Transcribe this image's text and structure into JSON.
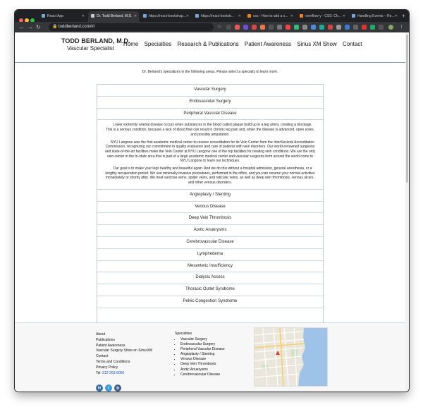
{
  "browser": {
    "tabs": [
      {
        "label": "React App"
      },
      {
        "label": "Dr. Todd Berland, M.D."
      },
      {
        "label": "https://react-bootstrap..."
      },
      {
        "label": "https://react-bootstr..."
      },
      {
        "label": "css - How to add a s..."
      },
      {
        "label": "overflow-y - CSS: Ch..."
      },
      {
        "label": "Handling Events – Re..."
      }
    ],
    "url": "toddberland.com/#/",
    "colors": {
      "close": "#ff5f57",
      "minimize": "#febc2e",
      "maximize": "#28c840"
    }
  },
  "site": {
    "brand_name": "TODD BERLAND, M.D.",
    "brand_sub": "Vascular Specialist",
    "nav": [
      "Home",
      "Specialties",
      "Research & Publications",
      "Patient Awareness",
      "Sirius XM Show",
      "Contact"
    ]
  },
  "main": {
    "intro": "Dr. Berland's specializes in the following areas. Please select a specialty to learn more.",
    "specialties_top": [
      "Vascular Surgery",
      "Endovascular Surgery",
      "Peripheral Vascular Disease"
    ],
    "expanded_paragraphs": [
      "Lower extremity arterial disease occurs when substances in the blood called plaque build up in a leg artery, creating a blockage. This is a serious condition, because a lack of blood flow can result in chronic leg pain and, when the disease is advanced, open sores, and possibly amputation.",
      "NYU Langone was the first academic medical center to receive accreditation for its Vein Center from the InterSocietal Accreditation Commission, recognizing our commitment to quality evaluation and care of patients with vein disorders. Our world-renowned surgeons and state-of-the-art facilities make the Vein Center at NYU Langone one of the top facilities for treating vein conditions. We are the only vein center in the tri-state area that is part of a large academic medical center and vascular surgeons from around the world come to NYU Langone to learn our techniques.",
      "Our goal is to make your legs healthy and beautiful again. And we do this without a hospital admission, general anesthesia, or a lengthy recuperation period. We use minimally invasive procedures, performed in the office, and you can resume your normal activities immediately or shortly after. We treat varicose veins, spider veins, and reticular veins, as well as deep vein thrombosis, venous ulcers, and other venous disorders."
    ],
    "specialties_bottom": [
      "Angioplasty / Stenting",
      "Venous Disease",
      "Deep Vein Thrombosis",
      "Aortic Anuerysms",
      "Cerebrovascular Disease",
      "Lymphedema",
      "Mesenteric Insufficiency",
      "Dialysis Access",
      "Thoracic Outlet Syndrome",
      "Pelvic Congestion Syndrome"
    ]
  },
  "footer": {
    "links": [
      "About",
      "Publications",
      "Patient Awareness",
      "Vascular Surgery Show on SiriusXM",
      "Contact",
      "Terms and Conditions",
      "Privacy Policy"
    ],
    "tel_label": "Tel:",
    "tel_number": "212-263-5060",
    "specialties_title": "Specialties",
    "specialties": [
      "Vascular Surgery",
      "Endovascular Surgery",
      "Peripheral Vascular Disease",
      "Angioplasty / Stenting",
      "Venous Disease",
      "Deep Vein Thrombosis",
      "Aortic Anuerysms",
      "Cerebrovascular Disease"
    ],
    "social": [
      {
        "icon": "linkedin-icon",
        "glyph": "in"
      },
      {
        "icon": "twitter-icon",
        "glyph": "t"
      },
      {
        "icon": "instagram-icon",
        "glyph": "◎"
      }
    ]
  }
}
